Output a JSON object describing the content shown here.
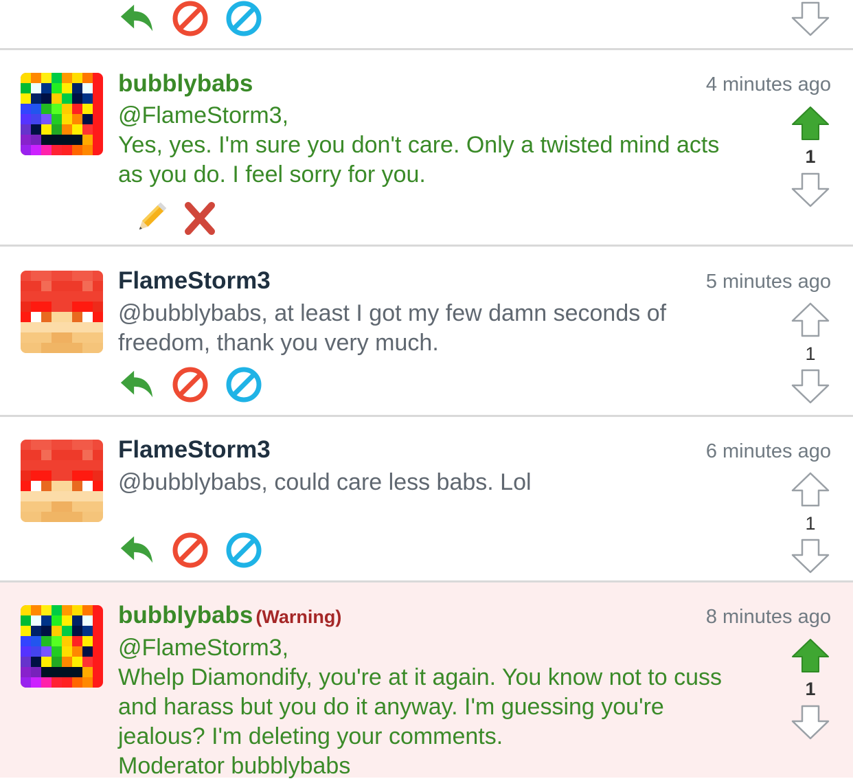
{
  "colors": {
    "mod_text": "#3a8a28",
    "user_name": "#1f3040",
    "user_text": "#5f6770",
    "warning": "#a52727",
    "warning_bg": "#fdeeee",
    "upvote_active": "#3fa632"
  },
  "icons": [
    "reply-icon",
    "flag-icon",
    "block-icon",
    "edit-icon",
    "delete-icon",
    "upvote-icon",
    "downvote-icon"
  ],
  "comments": [
    {
      "username": "bubblybabs",
      "timestamp": "4 minutes ago",
      "lines": [
        "@FlameStorm3,",
        "Yes, yes. I'm sure you don't care. Only a twisted mind acts",
        "as you do. I feel sorry for you."
      ],
      "votes": "1",
      "upvoted": true
    },
    {
      "username": "FlameStorm3",
      "timestamp": "5 minutes ago",
      "lines": [
        "@bubblybabs, at least I got my few damn seconds of",
        "freedom, thank you very much."
      ],
      "votes": "1",
      "upvoted": false
    },
    {
      "username": "FlameStorm3",
      "timestamp": "6 minutes ago",
      "lines": [
        "@bubblybabs, could care less babs. Lol"
      ],
      "votes": "1",
      "upvoted": false
    },
    {
      "username": "bubblybabs",
      "badge": "(Warning)",
      "timestamp": "8 minutes ago",
      "lines": [
        "@FlameStorm3,",
        "Whelp Diamondify, you're at it again. You know not to cuss",
        "and harass but you do it anyway. I'm guessing you're",
        "jealous? I'm deleting your comments.",
        "Moderator bubblybabs"
      ],
      "votes": "1",
      "upvoted": true
    }
  ]
}
